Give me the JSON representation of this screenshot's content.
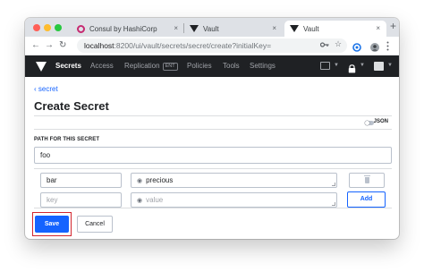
{
  "browser": {
    "tabs": [
      {
        "label": "Consul by HashiCorp",
        "close": "×"
      },
      {
        "label": "Vault",
        "close": "×"
      },
      {
        "label": "Vault",
        "close": "×"
      }
    ],
    "new_tab": "+",
    "url_host": "localhost",
    "url_path": ":8200/ui/vault/secrets/secret/create?initialKey="
  },
  "vault_nav": {
    "items": [
      "Secrets",
      "Access",
      "Replication",
      "Policies",
      "Tools",
      "Settings"
    ],
    "ent_badge": "ENT",
    "active": "Secrets"
  },
  "page": {
    "breadcrumb": "secret",
    "title": "Create Secret",
    "json_toggle_label": "JSON",
    "path_label": "PATH FOR THIS SECRET",
    "path_value": "foo"
  },
  "kv": {
    "rows": [
      {
        "key": "bar",
        "value": "precious"
      },
      {
        "key_placeholder": "key",
        "value_placeholder": "value"
      }
    ],
    "add_label": "Add"
  },
  "actions": {
    "save_label": "Save",
    "cancel_label": "Cancel"
  },
  "colors": {
    "accent": "#1563ff",
    "nav_bg": "#1f2124",
    "highlight": "#d3262f"
  }
}
